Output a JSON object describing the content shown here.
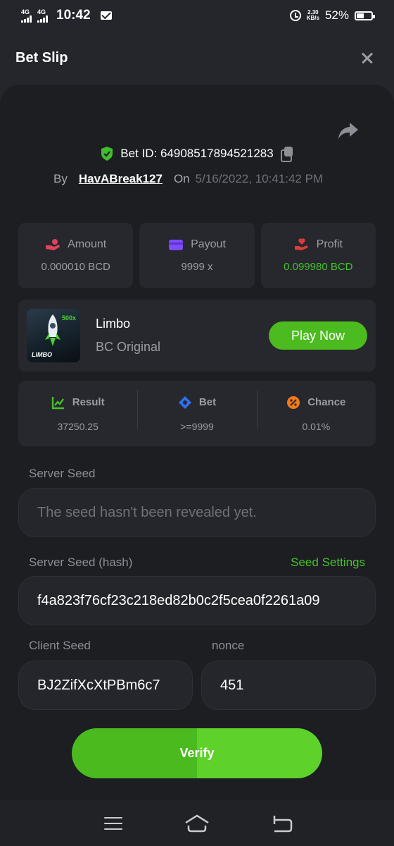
{
  "status_bar": {
    "network1": "4G",
    "network2": "4G",
    "time": "10:42",
    "speed_value": "2.30",
    "speed_unit": "KB/s",
    "battery": "52%",
    "battery_level": 0.52
  },
  "header": {
    "title": "Bet Slip"
  },
  "bet": {
    "id_label": "Bet ID: 64908517894521283",
    "by_label": "By",
    "user": "HavABreak127",
    "on_label": "On",
    "date": "5/16/2022, 10:41:42 PM"
  },
  "stats": [
    {
      "label": "Amount",
      "value": "0.000010 BCD",
      "icon": "money-hand-icon",
      "color": "#e2435a"
    },
    {
      "label": "Payout",
      "value": "9999 x",
      "icon": "wallet-icon",
      "color": "#7b4dff"
    },
    {
      "label": "Profit",
      "value": "0.099980 BCD",
      "icon": "profit-hand-icon",
      "color": "#e23b3b"
    }
  ],
  "game": {
    "name": "Limbo",
    "subtitle": "BC Original",
    "thumb_multiplier": "500x",
    "thumb_brand": "LIMBO",
    "play_label": "Play Now"
  },
  "results": [
    {
      "label": "Result",
      "value": "37250.25",
      "icon": "result-chart-icon",
      "color": "#47c12b"
    },
    {
      "label": "Bet",
      "value": ">=9999",
      "icon": "bet-tag-icon",
      "color": "#2f6ff0"
    },
    {
      "label": "Chance",
      "value": "0.01%",
      "icon": "percent-icon",
      "color": "#f07a1a"
    }
  ],
  "seeds": {
    "server_seed_label": "Server Seed",
    "server_seed_placeholder": "The seed hasn't been revealed yet.",
    "server_hash_label": "Server Seed (hash)",
    "seed_settings": "Seed Settings",
    "server_hash": "f4a823f76cf23c218ed82b0c2f5cea0f2261a09",
    "client_seed_label": "Client Seed",
    "client_seed": "BJ2ZifXcXtPBm6c7",
    "nonce_label": "nonce",
    "nonce": "451"
  },
  "verify_label": "Verify",
  "colors": {
    "accent": "#4cbb1f",
    "profit": "#47c12b"
  }
}
